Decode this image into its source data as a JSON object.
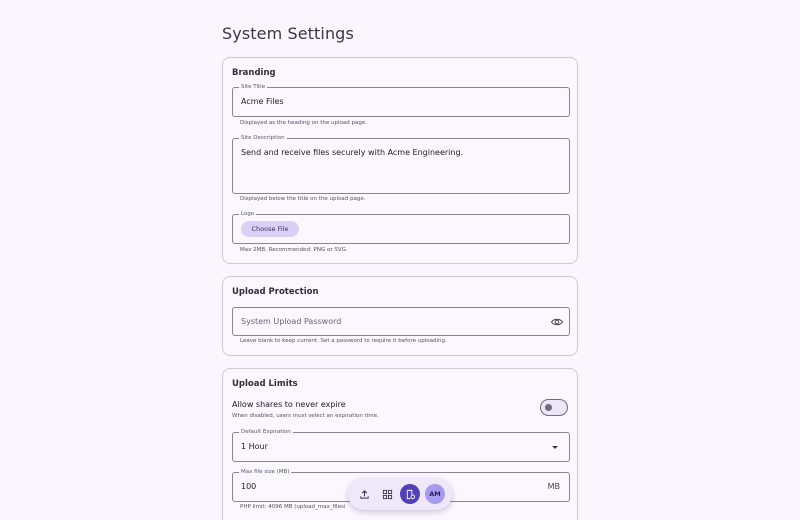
{
  "page": {
    "title": "System Settings"
  },
  "branding": {
    "title": "Branding",
    "site_title": {
      "label": "Site Title",
      "value": "Acme Files",
      "hint": "Displayed as the heading on the upload page."
    },
    "site_description": {
      "label": "Site Description",
      "value": "Send and receive files securely with Acme Engineering.",
      "hint": "Displayed below the title on the upload page."
    },
    "logo": {
      "label": "Logo",
      "button": "Choose File",
      "hint": "Max 2MB. Recommended: PNG or SVG."
    }
  },
  "upload_protection": {
    "title": "Upload Protection",
    "password": {
      "placeholder": "System Upload Password",
      "hint": "Leave blank to keep current. Set a password to require it before uploading."
    }
  },
  "upload_limits": {
    "title": "Upload Limits",
    "never_expire": {
      "label": "Allow shares to never expire",
      "hint": "When disabled, users must select an expiration time.",
      "enabled": false
    },
    "default_expiration": {
      "label": "Default Expiration",
      "value": "1 Hour"
    },
    "max_file_size": {
      "label": "Max file size (MB)",
      "value": "100",
      "suffix": "MB",
      "hint": "PHP limit: 4096 MB (upload_max_filesi"
    }
  },
  "fab": {
    "items": [
      "upload-icon",
      "grid-icon",
      "settings-shield-icon"
    ],
    "avatar_initials": "AM",
    "accent": "#5141b8"
  }
}
